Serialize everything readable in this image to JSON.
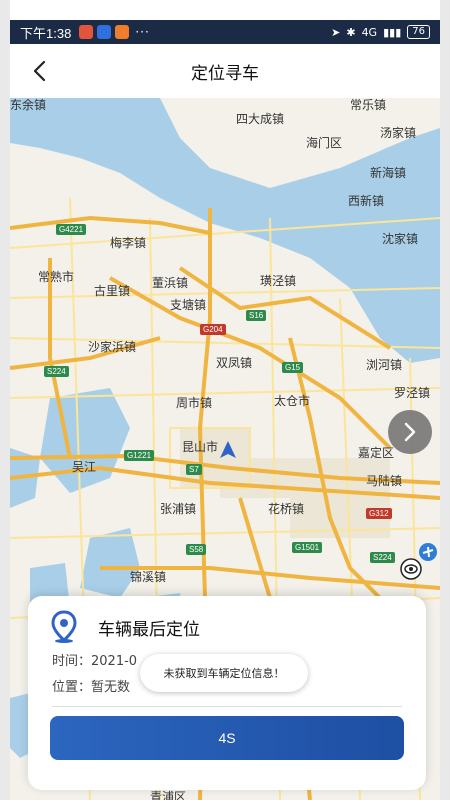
{
  "status_bar": {
    "time": "下午1:38",
    "dots": "···",
    "network": "4G",
    "battery": "76"
  },
  "header": {
    "title": "定位寻车",
    "back_icon": "chevron-left-icon"
  },
  "map": {
    "labels": {
      "l1": "东余镇",
      "l2": "常乐镇",
      "l3": "四大成镇",
      "l4": "汤家镇",
      "l5": "海门区",
      "l6": "新海镇",
      "l7": "西新镇",
      "l8": "沈家镇",
      "l9": "梅李镇",
      "l10": "常熟市",
      "l11": "古里镇",
      "l12": "董浜镇",
      "l13": "支塘镇",
      "l14": "璜泾镇",
      "l15": "沙家浜镇",
      "l16": "双凤镇",
      "l17": "浏河镇",
      "l18": "罗泾镇",
      "l19": "周市镇",
      "l20": "太仓市",
      "l21": "昆山市",
      "l22": "嘉定区",
      "l23": "马陆镇",
      "l24": "张浦镇",
      "l25": "花桥镇",
      "l26": "锦溪镇",
      "l27": "吴江",
      "l28": "青浦区"
    },
    "road_tags": {
      "r1": "G4221",
      "r2": "G204",
      "r3": "S16",
      "r4": "G15",
      "r5": "S224",
      "r6": "G1221",
      "r7": "S7",
      "r8": "G312",
      "r9": "G1501",
      "r10": "S58",
      "r11": "S224"
    },
    "colors": {
      "water": "#a9cfe8",
      "land": "#f3f1ea",
      "highway": "#f0b441",
      "road": "#fbe59a"
    }
  },
  "card": {
    "title": "车辆最后定位",
    "time_line": "时间：2021-0",
    "location_line": "位置：暂无数",
    "toast": "未获取到车辆定位信息！",
    "button_label": "4S"
  }
}
